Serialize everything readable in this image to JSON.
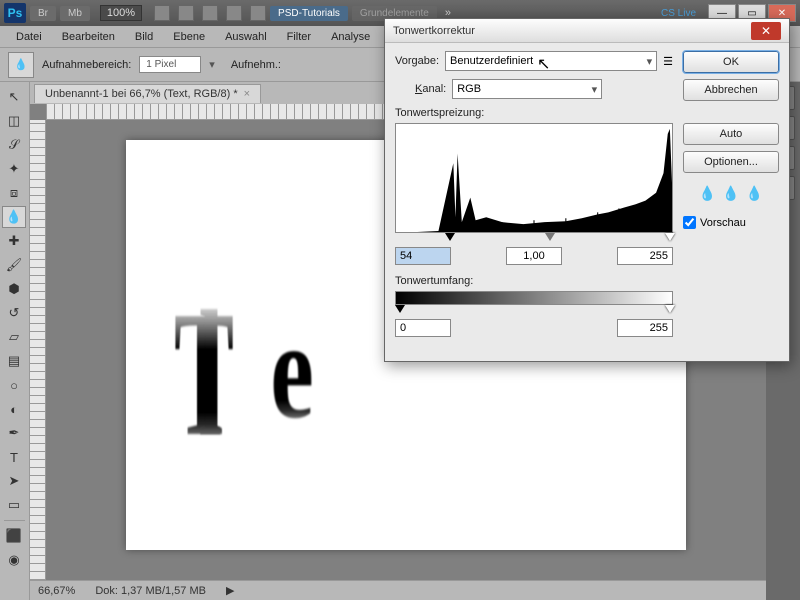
{
  "titlebar": {
    "zoom": "100%",
    "tabs": [
      "Br",
      "Mb"
    ],
    "psd_tab": "PSD-Tutorials",
    "grund_tab": "Grundelemente",
    "cs_live": "CS Live"
  },
  "menu": [
    "Datei",
    "Bearbeiten",
    "Bild",
    "Ebene",
    "Auswahl",
    "Filter",
    "Analyse"
  ],
  "options": {
    "label": "Aufnahmebereich:",
    "value": "1 Pixel",
    "label2": "Aufnehm.:"
  },
  "doc": {
    "tab": "Unbenannt-1 bei 66,7% (Text, RGB/8) *"
  },
  "status": {
    "zoom": "66,67%",
    "doc": "Dok: 1,37 MB/1,57 MB"
  },
  "dialog": {
    "title": "Tonwertkorrektur",
    "preset_label": "Vorgabe:",
    "preset_value": "Benutzerdefiniert",
    "channel_label": "Kanal:",
    "channel_value": "RGB",
    "spread_label": "Tonwertspreizung:",
    "input_black": "54",
    "input_gamma": "1,00",
    "input_white": "255",
    "output_label": "Tonwertumfang:",
    "output_black": "0",
    "output_white": "255",
    "ok": "OK",
    "cancel": "Abbrechen",
    "auto": "Auto",
    "options": "Optionen...",
    "preview": "Vorschau"
  }
}
